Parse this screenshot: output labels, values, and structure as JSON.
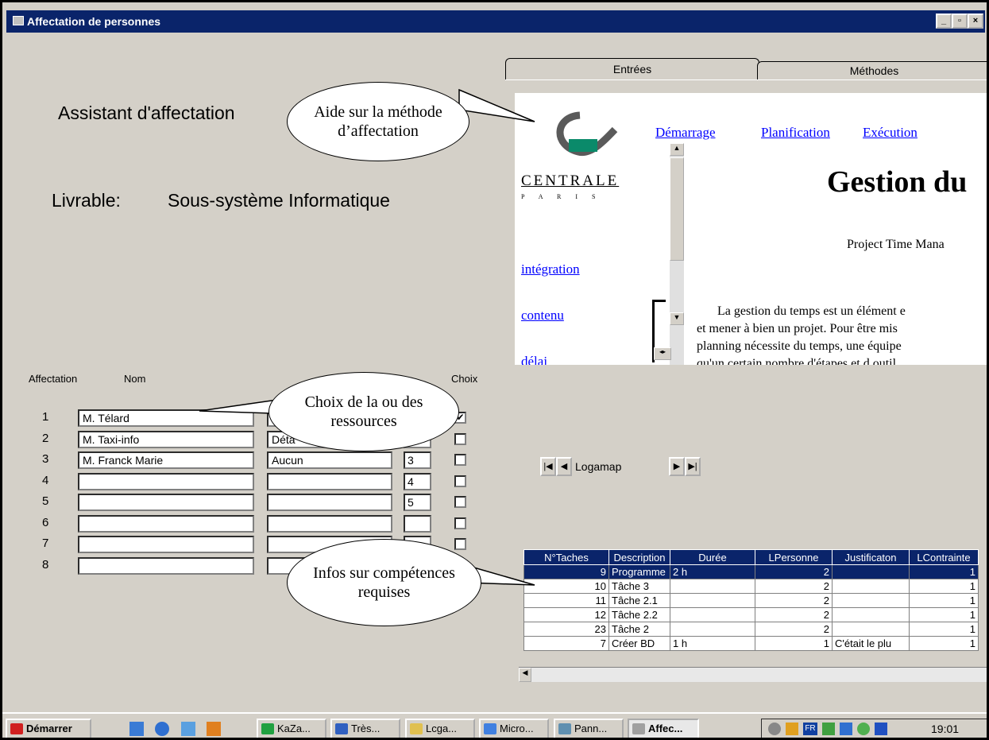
{
  "window": {
    "title": "Affectation de personnes",
    "controls": [
      "_",
      "▫",
      "×"
    ]
  },
  "left": {
    "assistant_title": "Assistant d'affectation",
    "livrable_label": "Livrable:",
    "livrable_value": "Sous-système Informatique",
    "headers": {
      "affectation": "Affectation",
      "nom": "Nom",
      "choix": "Choix"
    },
    "rows": [
      {
        "num": "1",
        "nom": "M. Télard",
        "comp": "",
        "rank": "",
        "checked": true
      },
      {
        "num": "2",
        "nom": "M. Taxi-info",
        "comp": "Déta",
        "rank": "",
        "checked": false
      },
      {
        "num": "3",
        "nom": "M. Franck Marie",
        "comp": "Aucun",
        "rank": "3",
        "checked": false
      },
      {
        "num": "4",
        "nom": "",
        "comp": "",
        "rank": "4",
        "checked": false
      },
      {
        "num": "5",
        "nom": "",
        "comp": "",
        "rank": "5",
        "checked": false
      },
      {
        "num": "6",
        "nom": "",
        "comp": "",
        "rank": "",
        "checked": false
      },
      {
        "num": "7",
        "nom": "",
        "comp": "",
        "rank": "",
        "checked": false
      },
      {
        "num": "8",
        "nom": "",
        "comp": "",
        "rank": "",
        "checked": false
      }
    ]
  },
  "tabs": {
    "entrees": "Entrées",
    "methodes": "Méthodes"
  },
  "web": {
    "nav": [
      "Démarrage",
      "Planification",
      "Exécution"
    ],
    "logo_text": "CENTRALE",
    "logo_sub": "P A R I S",
    "side_links": [
      "intégration",
      "contenu",
      "délai"
    ],
    "heading": "Gestion du",
    "subheading": "Project Time Mana",
    "body_lines": [
      "La gestion du temps est un élément e",
      "et mener à bien un projet. Pour être mis",
      "planning nécessite du temps, une équipe",
      "qu'un certain nombre d'étapes et d outil"
    ]
  },
  "nav_control": {
    "value": "Logamap"
  },
  "grid": {
    "headers": [
      "N°Taches",
      "Description",
      "Durée",
      "LPersonne",
      "Justificaton",
      "LContrainte"
    ],
    "rows": [
      [
        "9",
        "Programme",
        "2 h",
        "2",
        "",
        "1"
      ],
      [
        "10",
        "Tâche 3",
        "",
        "2",
        "",
        "1"
      ],
      [
        "11",
        "Tâche 2.1",
        "",
        "2",
        "",
        "1"
      ],
      [
        "12",
        "Tâche 2.2",
        "",
        "2",
        "",
        "1"
      ],
      [
        "23",
        "Tâche 2",
        "",
        "2",
        "",
        "1"
      ],
      [
        "7",
        "Créer BD",
        "1 h",
        "1",
        "C'était le plu",
        "1"
      ]
    ]
  },
  "callouts": {
    "aide": "Aide sur la méthode d’affectation",
    "choix": "Choix de la ou des ressources",
    "infos": "Infos sur compétences requises"
  },
  "taskbar": {
    "start": "Démarrer",
    "items": [
      "KaZa...",
      "Très...",
      "Lcga...",
      "Micro...",
      "Pann...",
      "Affec..."
    ],
    "clock": "19:01",
    "lang": "FR"
  }
}
